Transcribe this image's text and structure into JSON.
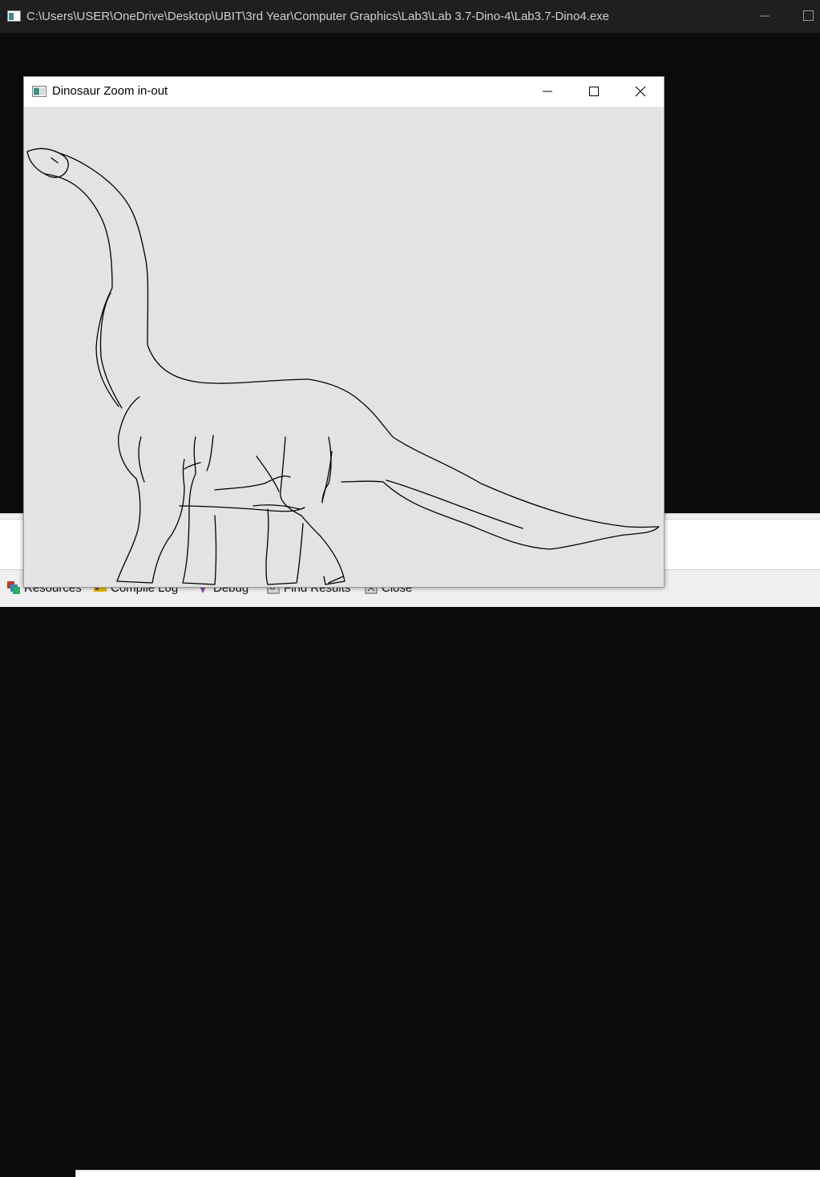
{
  "console": {
    "title": "C:\\Users\\USER\\OneDrive\\Desktop\\UBIT\\3rd Year\\Computer Graphics\\Lab3\\Lab 3.7-Dino-4\\Lab3.7-Dino4.exe",
    "icon": "console-app-icon"
  },
  "glut_window": {
    "title": "Dinosaur Zoom in-out",
    "icon": "app-window-icon",
    "canvas_background": "#e3e3e3",
    "line_color": "#000000"
  },
  "ide": {
    "tabs": [
      {
        "label": "Resources",
        "icon": "resources-icon"
      },
      {
        "label": "Compile Log",
        "icon": "compile-log-icon"
      },
      {
        "label": "Debug",
        "icon": "debug-icon"
      },
      {
        "label": "Find Results",
        "icon": "find-results-icon"
      },
      {
        "label": "Close",
        "icon": "close-panel-icon"
      }
    ]
  }
}
